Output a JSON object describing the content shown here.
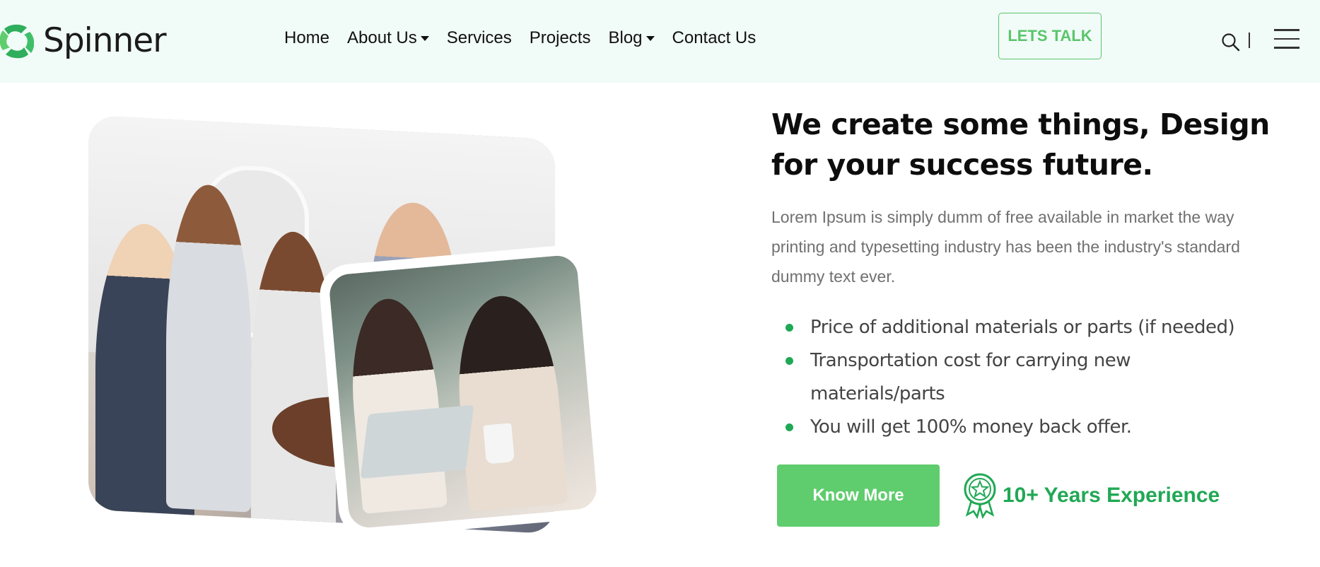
{
  "brand": {
    "name": "Spinner",
    "accent": "#5ac56b",
    "accent_dark": "#21a855"
  },
  "nav": {
    "items": [
      {
        "label": "Home",
        "dropdown": false
      },
      {
        "label": "About Us",
        "dropdown": true
      },
      {
        "label": "Services",
        "dropdown": false
      },
      {
        "label": "Projects",
        "dropdown": false
      },
      {
        "label": "Blog",
        "dropdown": true
      },
      {
        "label": "Contact Us",
        "dropdown": false
      }
    ],
    "cta": "LETS TALK"
  },
  "icons": {
    "logo": "spinner-logo-icon",
    "search": "search-icon",
    "menu": "hamburger-menu-icon",
    "award": "award-ribbon-icon"
  },
  "content": {
    "heading": "We create some things, Design for your success future.",
    "description": "Lorem Ipsum is simply dumm of free available in market the way printing and typesetting industry has been the industry's standard dummy text ever.",
    "bullets": [
      "Price of additional materials or parts (if needed)",
      "Transportation cost for carrying new materials/parts",
      "You will get 100% money back offer."
    ],
    "button": "Know More",
    "experience": "10+ Years Experience"
  }
}
